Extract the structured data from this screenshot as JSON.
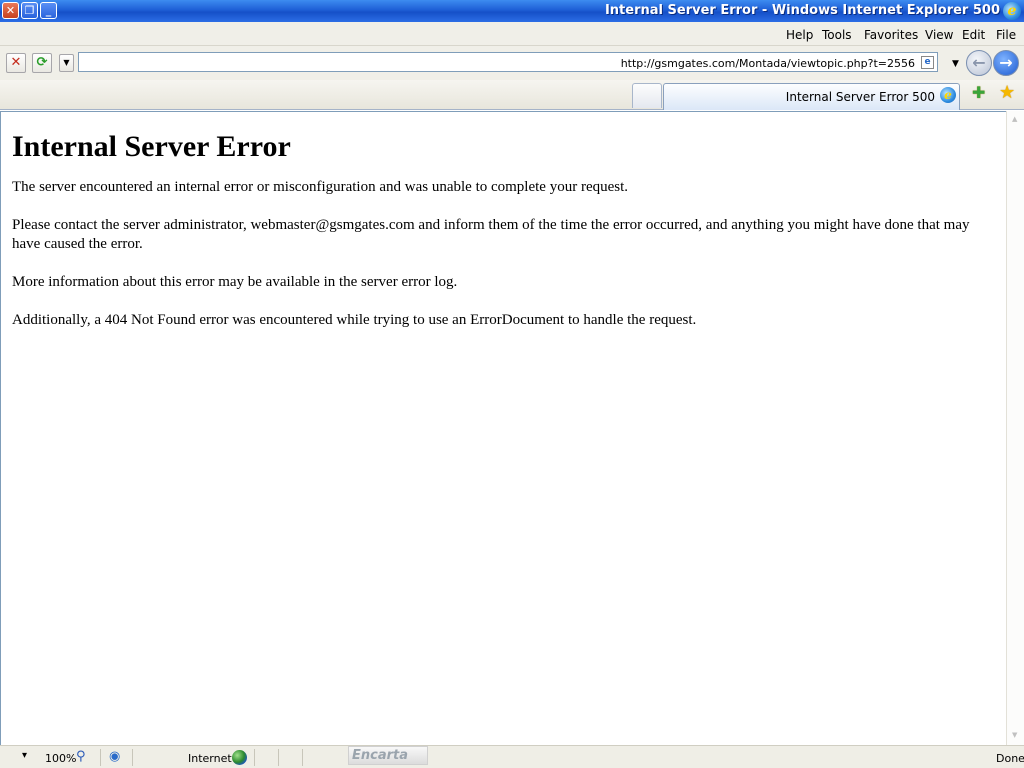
{
  "window": {
    "title": "Internal Server Error - Windows Internet Explorer 500",
    "logo_glyph": "e",
    "controls": {
      "close": "✕",
      "restore": "❐",
      "minimize": "_"
    }
  },
  "menu": {
    "items": [
      {
        "label": "Help"
      },
      {
        "label": "Tools"
      },
      {
        "label": "Favorites"
      },
      {
        "label": "View"
      },
      {
        "label": "Edit"
      },
      {
        "label": "File"
      }
    ]
  },
  "toolbar": {
    "stop_glyph": "✕",
    "refresh_glyph": "⟳",
    "dropdown_glyph": "▼",
    "address": "http://gsmgates.com/Montada/viewtopic.php?t=2556",
    "page_icon_glyph": "e",
    "back_glyph": "←",
    "forward_glyph": "→"
  },
  "tabs": {
    "active_label": "Internal Server Error 500",
    "add_favorite_glyph": "✚",
    "favorites_glyph": "★"
  },
  "page": {
    "heading": "Internal Server Error",
    "paragraphs": [
      "The server encountered an internal error or misconfiguration and was unable to complete your request.",
      "Please contact the server administrator, webmaster@gsmgates.com and inform them of the time the error occurred, and anything you might have done that may have caused the error.",
      "More information about this error may be available in the server error log.",
      "Additionally, a 404 Not Found error was encountered while trying to use an ErrorDocument to handle the request."
    ]
  },
  "scrollbar": {
    "up_glyph": "▲",
    "down_glyph": "▼"
  },
  "status": {
    "zoom_dropdown_glyph": "▾",
    "zoom": "100%",
    "zoom_glyph": "⚲",
    "protected_glyph": "◉",
    "zone": "Internet",
    "encarta": "Encarta",
    "state": "Done"
  },
  "colors": {
    "titlebar": "#1e5fd6",
    "chrome": "#f0efe8",
    "text": "#000000"
  }
}
